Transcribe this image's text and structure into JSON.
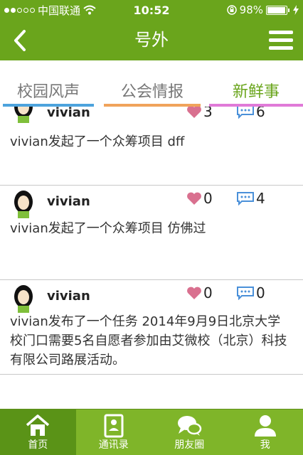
{
  "status_bar": {
    "carrier": "中国联通",
    "time": "10:52",
    "battery": "98%",
    "icons": [
      "signal-dots-icon",
      "wifi-icon",
      "orientation-lock-icon",
      "battery-icon",
      "charging-icon"
    ]
  },
  "nav": {
    "title": "号外",
    "back_icon": "chevron-left-icon",
    "menu_icon": "hamburger-menu-icon"
  },
  "tabs": [
    {
      "label": "校园风声",
      "color": "#4da3dd",
      "active": false
    },
    {
      "label": "公会情报",
      "color": "#f0a35b",
      "active": false
    },
    {
      "label": "新鲜事",
      "color": "#e07ad8",
      "active": true
    }
  ],
  "feed": [
    {
      "user": "vivian",
      "likes": "3",
      "comments": "6",
      "content": "vivian发起了一个众筹项目 dff"
    },
    {
      "user": "vivian",
      "likes": "0",
      "comments": "4",
      "content": "vivian发起了一个众筹项目 仿佛过"
    },
    {
      "user": "vivian",
      "likes": "0",
      "comments": "0",
      "content": "vivian发布了一个任务 2014年9月9日北京大学校门口需要5名自愿者参加由艾微校（北京）科技有限公司路展活动。"
    }
  ],
  "tabbar": [
    {
      "label": "首页",
      "icon": "home-icon",
      "active": true
    },
    {
      "label": "通讯录",
      "icon": "contacts-icon",
      "active": false
    },
    {
      "label": "朋友圈",
      "icon": "chat-bubbles-icon",
      "active": false
    },
    {
      "label": "我",
      "icon": "person-icon",
      "active": false
    }
  ],
  "colors": {
    "brand_green": "#6aa51c",
    "heart": "#d9708f",
    "comment_blue": "#4a90d9"
  }
}
